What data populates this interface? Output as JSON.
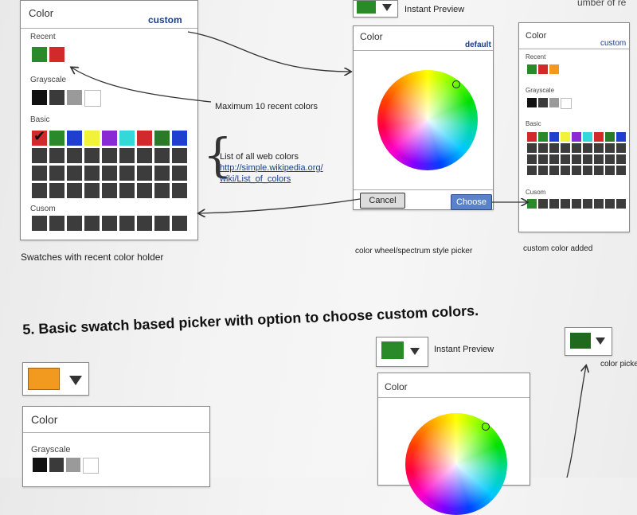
{
  "top_left_panel": {
    "title": "Color",
    "custom_link": "custom",
    "recent_label": "Recent",
    "grayscale_label": "Grayscale",
    "basic_label": "Basic",
    "custom_label": "Cusom",
    "caption": "Swatches with recent color holder",
    "recent_colors": [
      "#2a8a2a",
      "#d22a2a"
    ],
    "grayscale_colors": [
      "#111111",
      "#3a3a3a",
      "#9a9a9a",
      "#ffffff"
    ],
    "basic_colors": [
      "#d22a2a",
      "#2a8a2a",
      "#1f3fcf",
      "#f2f23a",
      "#8a2ad2",
      "#35d8d8",
      "#d22a2a",
      "#2a7a2a",
      "#1f3fcf"
    ]
  },
  "annotations": {
    "recent_note": "Maximum 10 recent colors",
    "web_colors_note": "List of all web colors",
    "web_colors_link_line1": "http://simple.wikipedia.org/",
    "web_colors_link_line2": "wiki/List_of_colors"
  },
  "wheel_picker": {
    "preview_label": "Instant Preview",
    "preview_color": "#2a8a2a",
    "title": "Color",
    "default_link": "default",
    "cancel_label": "Cancel",
    "choose_label": "Choose",
    "caption": "color wheel/spectrum style picker"
  },
  "right_panel": {
    "title": "Color",
    "custom_link": "custom",
    "recent_label": "Recent",
    "grayscale_label": "Grayscale",
    "basic_label": "Basic",
    "custom_label": "Cusom",
    "caption": "custom color added",
    "top_cut_text": "umber of re",
    "recent_colors": [
      "#2a8a2a",
      "#d22a2a",
      "#f29a1f"
    ],
    "grayscale_colors": [
      "#111111",
      "#3a3a3a",
      "#9a9a9a",
      "#ffffff"
    ],
    "basic_colors": [
      "#d22a2a",
      "#2a8a2a",
      "#1f3fcf",
      "#f2f23a",
      "#8a2ad2",
      "#35d8d8",
      "#d22a2a",
      "#2a7a2a",
      "#1f3fcf"
    ],
    "custom_color": "#2a8a2a"
  },
  "section5": {
    "heading": "5. Basic swatch based picker with option to choose custom colors."
  },
  "bottom_left": {
    "dropdown_color": "#f29a1f",
    "title": "Color",
    "grayscale_label": "Grayscale",
    "grayscale_colors": [
      "#111111",
      "#3a3a3a",
      "#9a9a9a",
      "#ffffff"
    ]
  },
  "bottom_middle": {
    "dropdown_color": "#2a8a2a",
    "preview_label": "Instant Preview",
    "title": "Color"
  },
  "bottom_right": {
    "dropdown_color": "#1f6a1f",
    "label": "color picked"
  }
}
